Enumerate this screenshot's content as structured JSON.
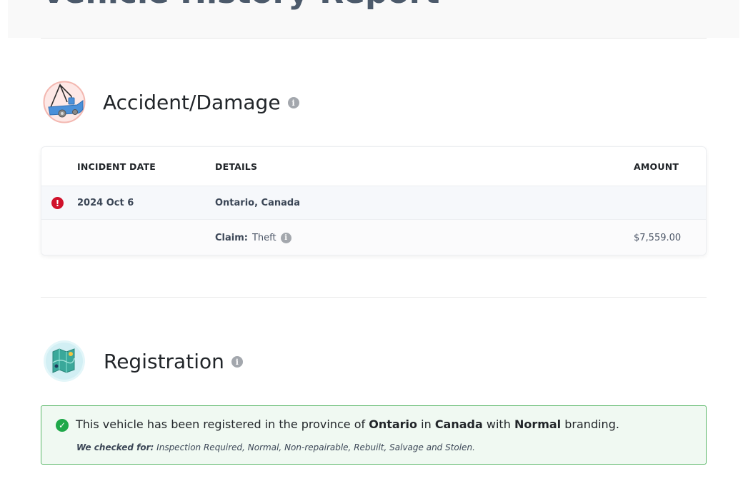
{
  "header": {
    "title": "Vehicle History Report"
  },
  "accident": {
    "title": "Accident/Damage",
    "info_glyph": "i",
    "icon": "tow-truck-icon",
    "columns": {
      "incident_date": "INCIDENT DATE",
      "details": "DETAILS",
      "amount": "AMOUNT"
    },
    "incident": {
      "alert_glyph": "!",
      "date": "2024 Oct 6",
      "location": "Ontario, Canada"
    },
    "claim": {
      "label": "Claim:",
      "type": "Theft",
      "amount": "$7,559.00"
    }
  },
  "registration": {
    "title": "Registration",
    "info_glyph": "i",
    "icon": "map-icon",
    "check_glyph": "✓",
    "message": {
      "prefix": "This vehicle has been registered in the province of",
      "province": "Ontario",
      "in_word": "in",
      "country": "Canada",
      "with_word": "with",
      "branding": "Normal",
      "suffix": "branding."
    },
    "checked_for_label": "We checked for:",
    "checked_for_list": "Inspection Required, Normal, Non-repairable, Rebuilt, Salvage and Stolen."
  },
  "colors": {
    "alert": "#d0112b",
    "success": "#1fa84a",
    "success_border": "#5cb86a"
  }
}
